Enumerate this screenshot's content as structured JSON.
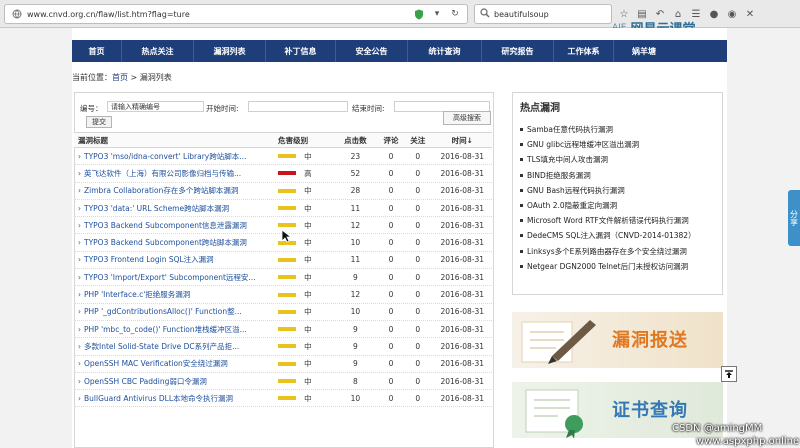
{
  "browser": {
    "url": "www.cnvd.org.cn/flaw/list.htm?flag=ture",
    "search_query": "beautifulsoup"
  },
  "watermark": {
    "logo_text": "网易云课堂",
    "mark_text": "AIE"
  },
  "nav": {
    "items": [
      {
        "label": "首页"
      },
      {
        "label": "热点关注"
      },
      {
        "label": "漏洞列表"
      },
      {
        "label": "补丁信息"
      },
      {
        "label": "安全公告"
      },
      {
        "label": "统计查询"
      },
      {
        "label": "研究报告"
      },
      {
        "label": "工作体系"
      },
      {
        "label": "娲羊塘"
      }
    ]
  },
  "breadcrumb": {
    "prefix": "当前位置：",
    "home": "首页",
    "sep": " > ",
    "current": "漏洞列表"
  },
  "search_form": {
    "id_label": "编号：",
    "id_placeholder": "请输入精确编号",
    "start_label": "开始时间:",
    "end_label": "结束时间:",
    "submit_label": "提交",
    "advanced_label": "高级搜索"
  },
  "table": {
    "headers": {
      "title": "漏洞标题",
      "level": "危害级别",
      "clicks": "点击数",
      "comments": "评论",
      "follows": "关注",
      "time": "时间↓"
    },
    "level_colors": {
      "中": "#e9c21b",
      "高": "#c8141b"
    },
    "rows": [
      {
        "title": "TYPO3 'mso/idna-convert' Library跨站脚本...",
        "level": "中",
        "clicks": "23",
        "comments": "0",
        "follows": "0",
        "date": "2016-08-31"
      },
      {
        "title": "英飞达软件（上海）有限公司影像归档与传输...",
        "level": "高",
        "clicks": "52",
        "comments": "0",
        "follows": "0",
        "date": "2016-08-31"
      },
      {
        "title": "Zimbra Collaboration存在多个跨站脚本漏洞",
        "level": "中",
        "clicks": "28",
        "comments": "0",
        "follows": "0",
        "date": "2016-08-31"
      },
      {
        "title": "TYPO3 'data:' URL Scheme跨站脚本漏洞",
        "level": "中",
        "clicks": "11",
        "comments": "0",
        "follows": "0",
        "date": "2016-08-31"
      },
      {
        "title": "TYPO3 Backend Subcomponent信息泄露漏洞",
        "level": "中",
        "clicks": "12",
        "comments": "0",
        "follows": "0",
        "date": "2016-08-31"
      },
      {
        "title": "TYPO3 Backend Subcomponent跨站脚本漏洞",
        "level": "中",
        "clicks": "10",
        "comments": "0",
        "follows": "0",
        "date": "2016-08-31"
      },
      {
        "title": "TYPO3 Frontend Login SQL注入漏洞",
        "level": "中",
        "clicks": "11",
        "comments": "0",
        "follows": "0",
        "date": "2016-08-31"
      },
      {
        "title": "TYPO3 'Import/Export' Subcomponent远程安...",
        "level": "中",
        "clicks": "9",
        "comments": "0",
        "follows": "0",
        "date": "2016-08-31"
      },
      {
        "title": "PHP 'Interface.c'拒绝服务漏洞",
        "level": "中",
        "clicks": "12",
        "comments": "0",
        "follows": "0",
        "date": "2016-08-31"
      },
      {
        "title": "PHP '_gdContributionsAlloc()' Function整...",
        "level": "中",
        "clicks": "10",
        "comments": "0",
        "follows": "0",
        "date": "2016-08-31"
      },
      {
        "title": "PHP 'mbc_to_code()' Function堆栈缓冲区溢...",
        "level": "中",
        "clicks": "9",
        "comments": "0",
        "follows": "0",
        "date": "2016-08-31"
      },
      {
        "title": "多款Intel Solid-State Drive DC系列产品拒...",
        "level": "中",
        "clicks": "9",
        "comments": "0",
        "follows": "0",
        "date": "2016-08-31"
      },
      {
        "title": "OpenSSH MAC Verification安全绕过漏洞",
        "level": "中",
        "clicks": "9",
        "comments": "0",
        "follows": "0",
        "date": "2016-08-31"
      },
      {
        "title": "OpenSSH CBC Padding弱口令漏洞",
        "level": "中",
        "clicks": "8",
        "comments": "0",
        "follows": "0",
        "date": "2016-08-31"
      },
      {
        "title": "BullGuard Antivirus DLL本地命令执行漏洞",
        "level": "中",
        "clicks": "10",
        "comments": "0",
        "follows": "0",
        "date": "2016-08-31"
      }
    ]
  },
  "hot": {
    "title": "热点漏洞",
    "items": [
      {
        "label": "Samba任意代码执行漏洞"
      },
      {
        "label": "GNU glibc远程堆缓冲区溢出漏洞"
      },
      {
        "label": "TLS填充中间人攻击漏洞"
      },
      {
        "label": "BIND拒绝服务漏洞"
      },
      {
        "label": "GNU Bash远程代码执行漏洞"
      },
      {
        "label": "OAuth 2.0隐蔽重定向漏洞"
      },
      {
        "label": "Microsoft Word RTF文件解析错误代码执行漏洞"
      },
      {
        "label": "DedeCMS SQL注入漏洞（CNVD-2014-01382）"
      },
      {
        "label": "Linksys多个E系列路由器存在多个安全绕过漏洞"
      },
      {
        "label": "Netgear DGN2000 Telnet后门未授权访问漏洞"
      }
    ]
  },
  "banners": {
    "report": "漏洞报送",
    "cert": "证书查询"
  },
  "side_tab": "分享",
  "credits": {
    "csdn": "CSDN @amingMM",
    "aspx": "www.aspxphp.online"
  }
}
